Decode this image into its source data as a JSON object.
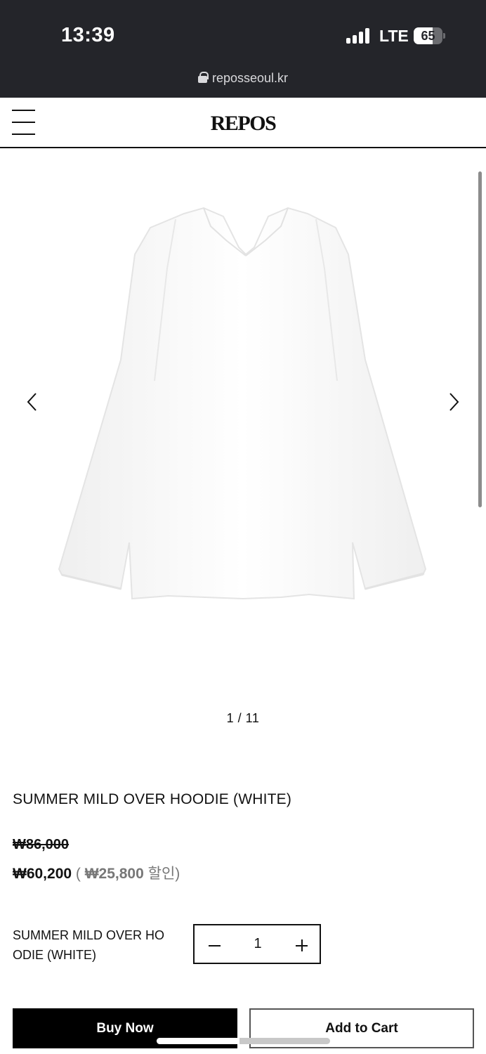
{
  "status_bar": {
    "time": "13:39",
    "network": "LTE",
    "battery_level": "65",
    "battery_fraction": 0.65,
    "signal_icon": "cellular-signal-icon",
    "battery_icon": "battery-icon"
  },
  "browser": {
    "url": "reposseoul.kr",
    "lock_icon": "lock-icon"
  },
  "header": {
    "logo": "REPOS",
    "menu_icon": "hamburger-menu-icon"
  },
  "gallery": {
    "counter": "1 / 11",
    "current": 1,
    "total": 11,
    "prev_icon": "chevron-left-icon",
    "next_icon": "chevron-right-icon"
  },
  "product": {
    "title": "SUMMER MILD OVER HOODIE (WHITE)",
    "original_price": "₩86,000",
    "sale_price": "₩60,200",
    "discount_open": " ( ",
    "discount_amount": "₩25,800",
    "discount_suffix": " 할인)"
  },
  "option": {
    "name": "SUMMER MILD OVER HO ODIE (WHITE)",
    "quantity": "1"
  },
  "actions": {
    "buy_now": "Buy Now",
    "add_to_cart": "Add to Cart"
  },
  "colors": {
    "status_bar_bg": "#24252a",
    "primary": "#000000",
    "discount_text": "#777777"
  }
}
